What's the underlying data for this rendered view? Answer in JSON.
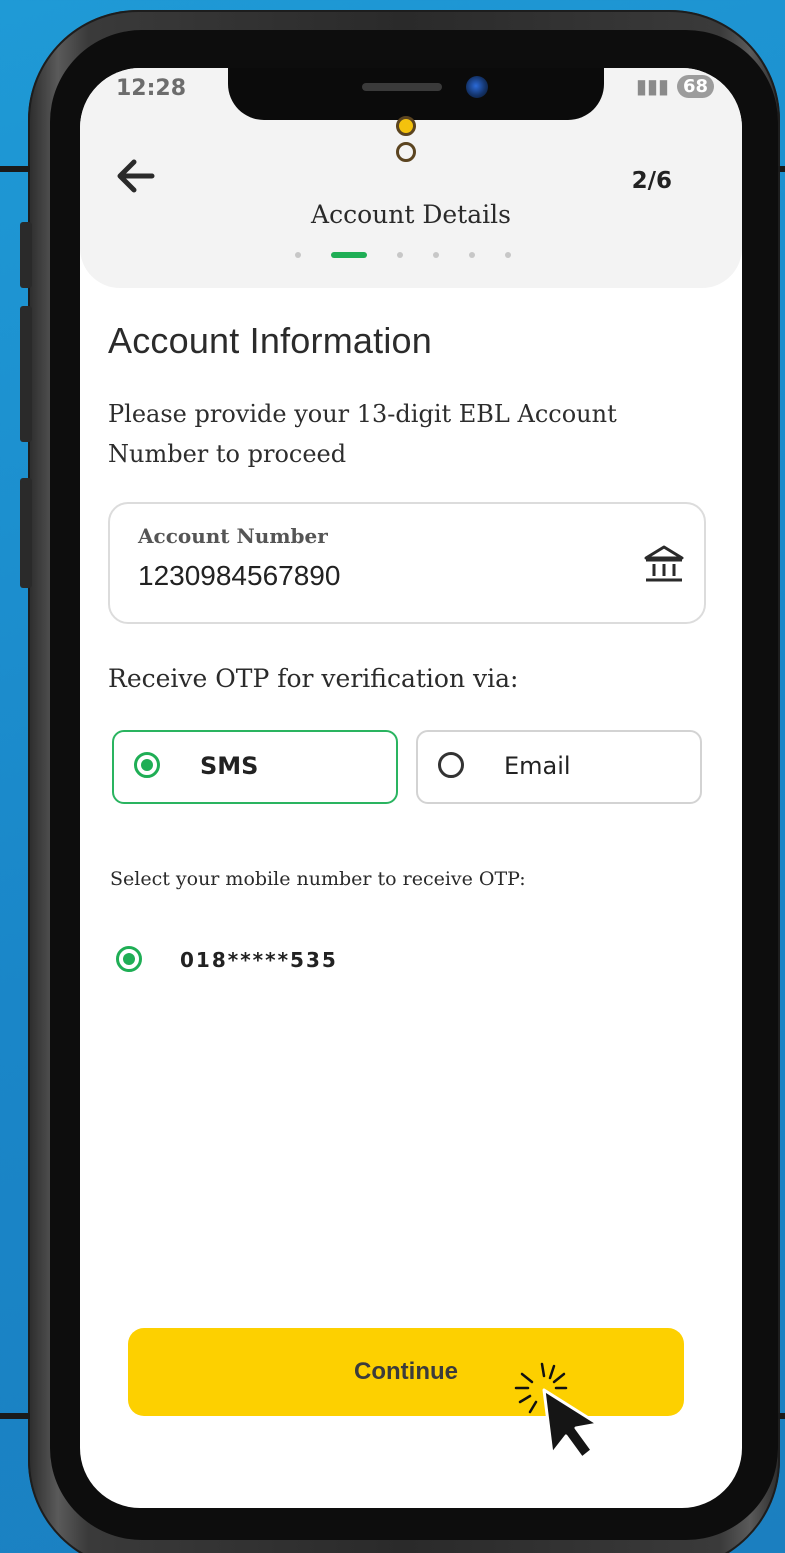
{
  "status_bar": {
    "time": "12:28",
    "battery": "68"
  },
  "header": {
    "title": "Account Details",
    "step_counter": "2/6",
    "steps_total": 6,
    "current_step": 2
  },
  "section": {
    "title": "Account Information",
    "description": "Please provide your 13-digit EBL Account Number to proceed"
  },
  "account_field": {
    "label": "Account Number",
    "value": "1230984567890",
    "icon": "bank-icon"
  },
  "otp": {
    "label": "Receive OTP for verification via:",
    "options": [
      {
        "label": "SMS",
        "selected": true
      },
      {
        "label": "Email",
        "selected": false
      }
    ]
  },
  "mobile": {
    "label": "Select your mobile number to receive OTP:",
    "number": "018*****535",
    "selected": true
  },
  "actions": {
    "continue_label": "Continue"
  },
  "colors": {
    "accent_green": "#1fae55",
    "button_yellow": "#fdd000",
    "background_blue": "#1a86c8"
  }
}
